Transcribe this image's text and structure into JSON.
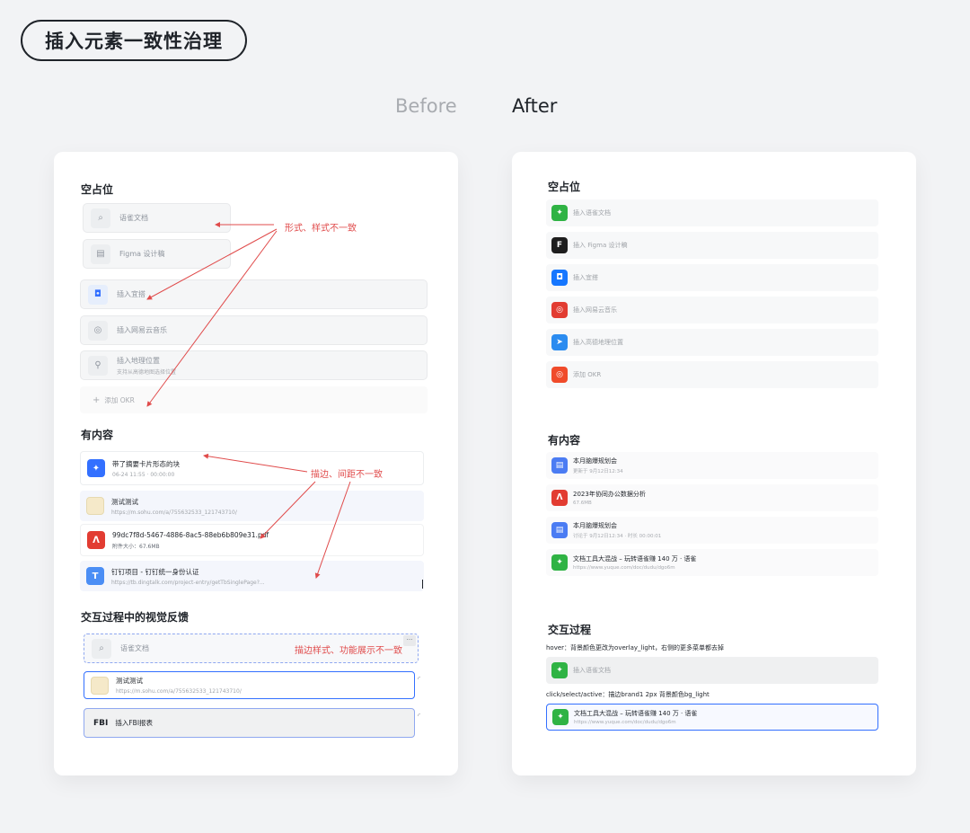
{
  "page": {
    "title": "插入元素一致性治理",
    "before_label": "Before",
    "after_label": "After"
  },
  "before": {
    "placeholder": {
      "title": "空占位",
      "items": [
        {
          "label": "语雀文档"
        },
        {
          "label": "Figma 设计稿"
        },
        {
          "label": "插入宜搭"
        },
        {
          "label": "插入网易云音乐"
        },
        {
          "label": "插入地理位置",
          "sub": "支持从高德地图选择位置"
        },
        {
          "label": "添加 OKR"
        }
      ],
      "annotation": "形式、样式不一致"
    },
    "content": {
      "title": "有内容",
      "items": [
        {
          "title": "带了摘要卡片形态的块",
          "sub": "06-24 11:55 · 00:00:00"
        },
        {
          "title": "测试测试",
          "sub": "https://m.sohu.com/a/755632533_121743710/"
        },
        {
          "title": "99dc7f8d-5467-4886-8ac5-88eb6b809e31.pdf",
          "sub": "附件大小：67.6MB"
        },
        {
          "title": "钉钉项目 - 钉钉统一身份认证",
          "sub": "https://tb.dingtalk.com/project-entry/getTbSinglePage?..."
        }
      ],
      "annotation": "描边、间距不一致"
    },
    "interaction": {
      "title": "交互过程中的视觉反馈",
      "items": [
        {
          "label": "语雀文档"
        },
        {
          "title": "测试测试",
          "sub": "https://m.sohu.com/a/755632533_121743710/"
        },
        {
          "icon_text": "FBI",
          "label": "插入FBI报表"
        }
      ],
      "annotation": "描边样式、功能展示不一致",
      "more": "···"
    }
  },
  "after": {
    "placeholder": {
      "title": "空占位",
      "items": [
        {
          "label": "插入语雀文档",
          "color": "#2fb344"
        },
        {
          "label": "插入 Figma 设计稿",
          "color": "#1e1e1e"
        },
        {
          "label": "插入宜搭",
          "color": "#1677ff"
        },
        {
          "label": "插入网易云音乐",
          "color": "#e23c32"
        },
        {
          "label": "插入高德地理位置",
          "color": "#2b8cf0"
        },
        {
          "label": "添加 OKR",
          "color": "#f04b2a"
        }
      ]
    },
    "content": {
      "title": "有内容",
      "items": [
        {
          "title": "本月脑爆规划会",
          "sub": "更新于 9月12日12:34",
          "color": "#4b7cf3"
        },
        {
          "title": "2023年协同办公数据分析",
          "sub": "67.6MB",
          "color": "#e23c32"
        },
        {
          "title": "本月脑爆规划会",
          "sub": "讨论于 9月12日12:34 · 时长 00:00:01",
          "color": "#4b7cf3"
        },
        {
          "title": "文档工具大混战 – 玩转语雀赚 140 万 · 语雀",
          "sub": "https://www.yuque.com/doc/dudu/dgo6m",
          "color": "#2fb344"
        }
      ]
    },
    "interaction": {
      "title": "交互过程",
      "hover_note": "hover：背景颜色更改为overlay_light，右侧的更多菜单都去掉",
      "hover_item": {
        "label": "插入语雀文档"
      },
      "click_note": "click/select/active：描边brand1 2px  背景颜色bg_light",
      "click_item": {
        "title": "文档工具大混战 – 玩转语雀赚 140 万 · 语雀",
        "sub": "https://www.yuque.com/doc/dudu/dgo6m"
      }
    }
  },
  "colors": {
    "annotation": "#e04b4b",
    "brand": "#3370ff"
  }
}
